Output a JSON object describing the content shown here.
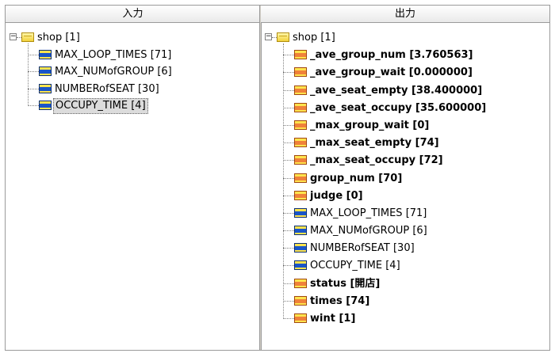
{
  "left_pane": {
    "header": "入力",
    "root": {
      "label": "shop [1]"
    },
    "items": [
      {
        "label": "MAX_LOOP_TIMES [71]",
        "icon": "variable-icon-blue",
        "bold": false,
        "selected": false
      },
      {
        "label": "MAX_NUMofGROUP [6]",
        "icon": "variable-icon-blue",
        "bold": false,
        "selected": false
      },
      {
        "label": "NUMBERofSEAT [30]",
        "icon": "variable-icon-blue",
        "bold": false,
        "selected": false
      },
      {
        "label": "OCCUPY_TIME [4]",
        "icon": "variable-icon-blue",
        "bold": false,
        "selected": true
      }
    ]
  },
  "right_pane": {
    "header": "出力",
    "root": {
      "label": "shop [1]"
    },
    "items": [
      {
        "label": "_ave_group_num [3.760563]",
        "icon": "variable-icon-red",
        "bold": true
      },
      {
        "label": "_ave_group_wait [0.000000]",
        "icon": "variable-icon-red",
        "bold": true
      },
      {
        "label": "_ave_seat_empty [38.400000]",
        "icon": "variable-icon-red",
        "bold": true
      },
      {
        "label": "_ave_seat_occupy [35.600000]",
        "icon": "variable-icon-red",
        "bold": true
      },
      {
        "label": "_max_group_wait [0]",
        "icon": "variable-icon-red",
        "bold": true
      },
      {
        "label": "_max_seat_empty [74]",
        "icon": "variable-icon-red",
        "bold": true
      },
      {
        "label": "_max_seat_occupy [72]",
        "icon": "variable-icon-red",
        "bold": true
      },
      {
        "label": "group_num [70]",
        "icon": "variable-icon-red",
        "bold": true
      },
      {
        "label": "judge [0]",
        "icon": "variable-icon-red",
        "bold": true
      },
      {
        "label": "MAX_LOOP_TIMES [71]",
        "icon": "variable-icon-blue",
        "bold": false
      },
      {
        "label": "MAX_NUMofGROUP [6]",
        "icon": "variable-icon-blue",
        "bold": false
      },
      {
        "label": "NUMBERofSEAT [30]",
        "icon": "variable-icon-blue",
        "bold": false
      },
      {
        "label": "OCCUPY_TIME [4]",
        "icon": "variable-icon-blue",
        "bold": false
      },
      {
        "label": "status [開店]",
        "icon": "variable-icon-red",
        "bold": true
      },
      {
        "label": "times [74]",
        "icon": "variable-icon-red",
        "bold": true
      },
      {
        "label": "wint [1]",
        "icon": "variable-icon-red",
        "bold": true
      }
    ]
  },
  "colors": {
    "selection_bg": "#dcdcdc",
    "blue_icon": "#1a56c8",
    "red_icon": "#f0813a",
    "folder_icon": "#f2d23b"
  }
}
